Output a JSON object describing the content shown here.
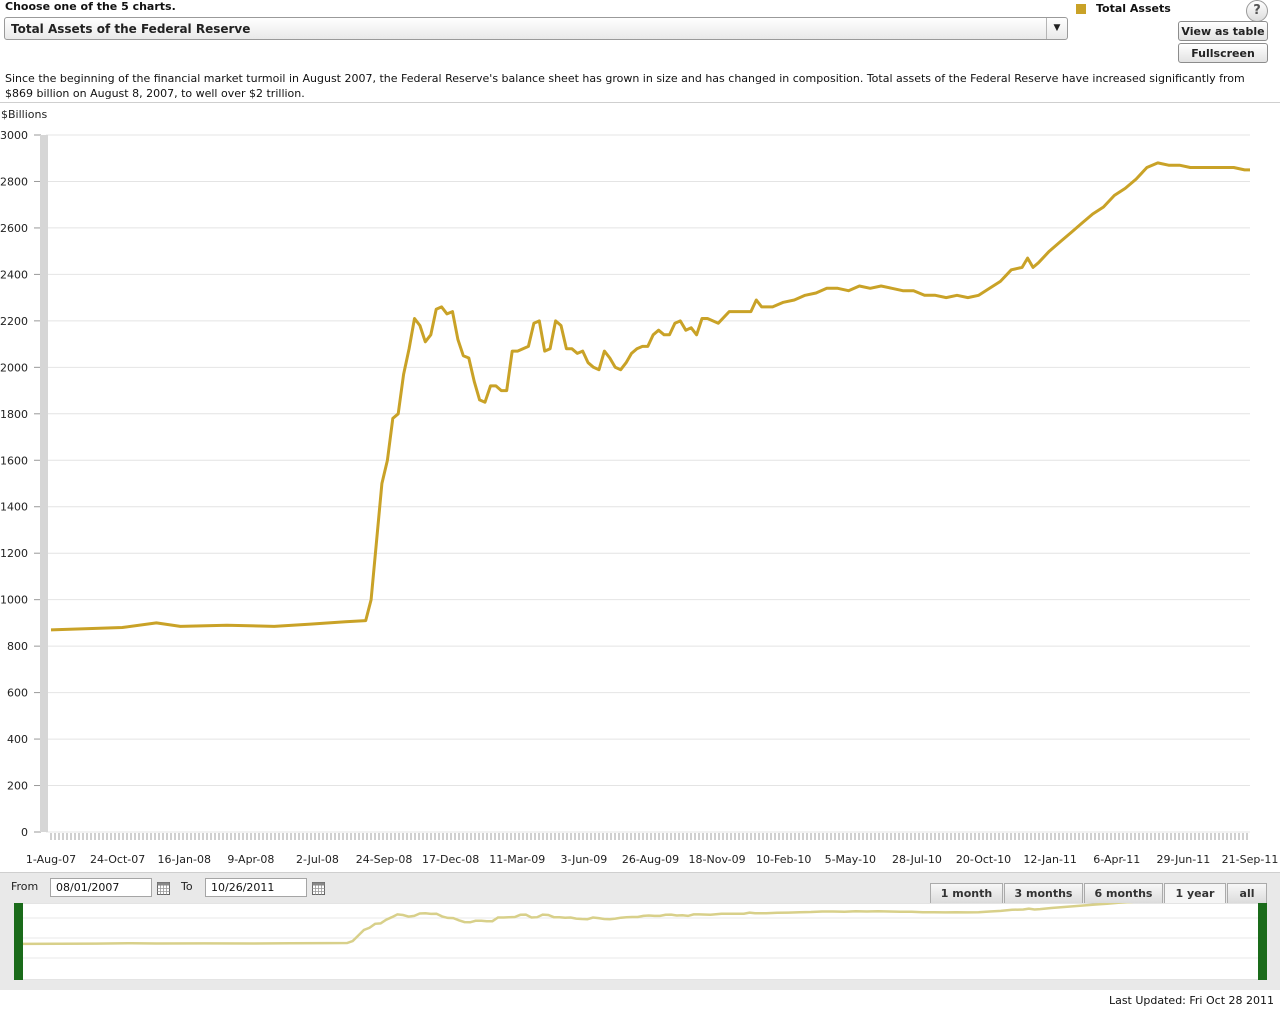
{
  "header": {
    "choose_label": "Choose one of the 5 charts.",
    "selected_chart": "Total Assets of the Federal Reserve",
    "legend_label": "Total Assets",
    "help_symbol": "?",
    "view_table_label": "View as table",
    "fullscreen_label": "Fullscreen"
  },
  "description": "Since the beginning of the financial market turmoil in August 2007, the Federal Reserve's balance sheet has grown in size and has changed in composition. Total assets of the Federal Reserve have increased significantly from $869 billion on August 8, 2007, to well over $2 trillion.",
  "controls": {
    "from_label": "From",
    "from_value": "08/01/2007",
    "to_label": "To",
    "to_value": "10/26/2011",
    "ranges": [
      "1 month",
      "3 months",
      "6 months",
      "1 year",
      "all"
    ],
    "active_range": "1 year"
  },
  "footer": {
    "last_updated": "Last Updated: Fri Oct 28 2011"
  },
  "colors": {
    "series": "#c9a227",
    "navigator_series": "#d8d08a",
    "navigator_handle": "#1a6b1a",
    "grid": "#e4e4e4"
  },
  "chart_data": {
    "type": "line",
    "ylabel": "$Billions",
    "ylim": [
      0,
      3000
    ],
    "yticks": [
      0,
      200,
      400,
      600,
      800,
      1000,
      1200,
      1400,
      1600,
      1800,
      2000,
      2200,
      2400,
      2600,
      2800,
      3000
    ],
    "x_start": "1-Aug-07",
    "x_end": "26-Oct-11",
    "x_tick_labels": [
      "1-Aug-07",
      "24-Oct-07",
      "16-Jan-08",
      "9-Apr-08",
      "2-Jul-08",
      "24-Sep-08",
      "17-Dec-08",
      "11-Mar-09",
      "3-Jun-09",
      "26-Aug-09",
      "18-Nov-09",
      "10-Feb-10",
      "5-May-10",
      "28-Jul-10",
      "20-Oct-10",
      "12-Jan-11",
      "6-Apr-11",
      "29-Jun-11",
      "21-Sep-11"
    ],
    "grid": true,
    "series": [
      {
        "name": "Total Assets",
        "points": [
          [
            "1-Aug-07",
            870
          ],
          [
            "1-Nov-07",
            880
          ],
          [
            "15-Dec-07",
            900
          ],
          [
            "15-Jan-08",
            885
          ],
          [
            "15-Mar-08",
            890
          ],
          [
            "15-May-08",
            885
          ],
          [
            "1-Jul-08",
            895
          ],
          [
            "15-Aug-08",
            905
          ],
          [
            "10-Sep-08",
            910
          ],
          [
            "17-Sep-08",
            1000
          ],
          [
            "24-Sep-08",
            1250
          ],
          [
            "1-Oct-08",
            1500
          ],
          [
            "8-Oct-08",
            1600
          ],
          [
            "15-Oct-08",
            1780
          ],
          [
            "22-Oct-08",
            1800
          ],
          [
            "29-Oct-08",
            1970
          ],
          [
            "5-Nov-08",
            2080
          ],
          [
            "12-Nov-08",
            2210
          ],
          [
            "19-Nov-08",
            2180
          ],
          [
            "26-Nov-08",
            2110
          ],
          [
            "3-Dec-08",
            2140
          ],
          [
            "10-Dec-08",
            2250
          ],
          [
            "17-Dec-08",
            2260
          ],
          [
            "24-Dec-08",
            2230
          ],
          [
            "31-Dec-08",
            2240
          ],
          [
            "7-Jan-09",
            2120
          ],
          [
            "14-Jan-09",
            2050
          ],
          [
            "21-Jan-09",
            2040
          ],
          [
            "28-Jan-09",
            1940
          ],
          [
            "4-Feb-09",
            1860
          ],
          [
            "11-Feb-09",
            1850
          ],
          [
            "18-Feb-09",
            1920
          ],
          [
            "25-Feb-09",
            1920
          ],
          [
            "4-Mar-09",
            1900
          ],
          [
            "11-Mar-09",
            1900
          ],
          [
            "18-Mar-09",
            2070
          ],
          [
            "25-Mar-09",
            2070
          ],
          [
            "1-Apr-09",
            2080
          ],
          [
            "8-Apr-09",
            2090
          ],
          [
            "15-Apr-09",
            2190
          ],
          [
            "22-Apr-09",
            2200
          ],
          [
            "29-Apr-09",
            2070
          ],
          [
            "6-May-09",
            2080
          ],
          [
            "13-May-09",
            2200
          ],
          [
            "20-May-09",
            2180
          ],
          [
            "27-May-09",
            2080
          ],
          [
            "3-Jun-09",
            2080
          ],
          [
            "10-Jun-09",
            2060
          ],
          [
            "17-Jun-09",
            2070
          ],
          [
            "24-Jun-09",
            2020
          ],
          [
            "1-Jul-09",
            2000
          ],
          [
            "8-Jul-09",
            1990
          ],
          [
            "15-Jul-09",
            2070
          ],
          [
            "22-Jul-09",
            2040
          ],
          [
            "29-Jul-09",
            2000
          ],
          [
            "5-Aug-09",
            1990
          ],
          [
            "12-Aug-09",
            2020
          ],
          [
            "19-Aug-09",
            2060
          ],
          [
            "26-Aug-09",
            2080
          ],
          [
            "2-Sep-09",
            2090
          ],
          [
            "9-Sep-09",
            2090
          ],
          [
            "16-Sep-09",
            2140
          ],
          [
            "23-Sep-09",
            2160
          ],
          [
            "30-Sep-09",
            2140
          ],
          [
            "7-Oct-09",
            2140
          ],
          [
            "14-Oct-09",
            2190
          ],
          [
            "21-Oct-09",
            2200
          ],
          [
            "28-Oct-09",
            2160
          ],
          [
            "4-Nov-09",
            2170
          ],
          [
            "11-Nov-09",
            2140
          ],
          [
            "18-Nov-09",
            2210
          ],
          [
            "25-Nov-09",
            2210
          ],
          [
            "9-Dec-09",
            2190
          ],
          [
            "23-Dec-09",
            2240
          ],
          [
            "6-Jan-10",
            2240
          ],
          [
            "20-Jan-10",
            2240
          ],
          [
            "27-Jan-10",
            2290
          ],
          [
            "3-Feb-10",
            2260
          ],
          [
            "17-Feb-10",
            2260
          ],
          [
            "3-Mar-10",
            2280
          ],
          [
            "17-Mar-10",
            2290
          ],
          [
            "31-Mar-10",
            2310
          ],
          [
            "14-Apr-10",
            2320
          ],
          [
            "28-Apr-10",
            2340
          ],
          [
            "12-May-10",
            2340
          ],
          [
            "26-May-10",
            2330
          ],
          [
            "9-Jun-10",
            2350
          ],
          [
            "23-Jun-10",
            2340
          ],
          [
            "7-Jul-10",
            2350
          ],
          [
            "21-Jul-10",
            2340
          ],
          [
            "4-Aug-10",
            2330
          ],
          [
            "18-Aug-10",
            2330
          ],
          [
            "1-Sep-10",
            2310
          ],
          [
            "15-Sep-10",
            2310
          ],
          [
            "29-Sep-10",
            2300
          ],
          [
            "13-Oct-10",
            2310
          ],
          [
            "27-Oct-10",
            2300
          ],
          [
            "10-Nov-10",
            2310
          ],
          [
            "24-Nov-10",
            2340
          ],
          [
            "8-Dec-10",
            2370
          ],
          [
            "22-Dec-10",
            2420
          ],
          [
            "5-Jan-11",
            2430
          ],
          [
            "12-Jan-11",
            2470
          ],
          [
            "19-Jan-11",
            2430
          ],
          [
            "26-Jan-11",
            2450
          ],
          [
            "9-Feb-11",
            2500
          ],
          [
            "23-Feb-11",
            2540
          ],
          [
            "9-Mar-11",
            2580
          ],
          [
            "23-Mar-11",
            2620
          ],
          [
            "6-Apr-11",
            2660
          ],
          [
            "20-Apr-11",
            2690
          ],
          [
            "4-May-11",
            2740
          ],
          [
            "18-May-11",
            2770
          ],
          [
            "1-Jun-11",
            2810
          ],
          [
            "15-Jun-11",
            2860
          ],
          [
            "29-Jun-11",
            2880
          ],
          [
            "13-Jul-11",
            2870
          ],
          [
            "27-Jul-11",
            2870
          ],
          [
            "10-Aug-11",
            2860
          ],
          [
            "24-Aug-11",
            2860
          ],
          [
            "7-Sep-11",
            2860
          ],
          [
            "21-Sep-11",
            2860
          ],
          [
            "5-Oct-11",
            2860
          ],
          [
            "19-Oct-11",
            2850
          ],
          [
            "26-Oct-11",
            2850
          ]
        ]
      }
    ]
  }
}
